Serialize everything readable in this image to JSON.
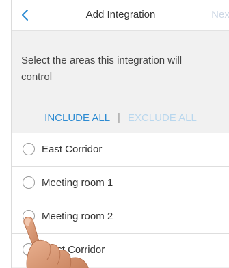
{
  "header": {
    "back_icon": "chevron-left-icon",
    "title": "Add Integration",
    "next_label": "Next"
  },
  "instruction": "Select the areas this integration will control",
  "actions": {
    "include_all": "INCLUDE ALL",
    "separator": "|",
    "exclude_all": "EXCLUDE ALL"
  },
  "areas": [
    {
      "label": "East Corridor",
      "selected": false
    },
    {
      "label": "Meeting room 1",
      "selected": false
    },
    {
      "label": "Meeting room 2",
      "selected": false
    },
    {
      "label": "West Corridor",
      "selected": false
    }
  ],
  "colors": {
    "accent": "#2d8bd2",
    "accent_disabled": "#b9d7ee",
    "next_disabled": "#cfd9e6",
    "background": "#f1f1f1"
  },
  "overlay": {
    "icon": "pointing-hand-icon"
  }
}
